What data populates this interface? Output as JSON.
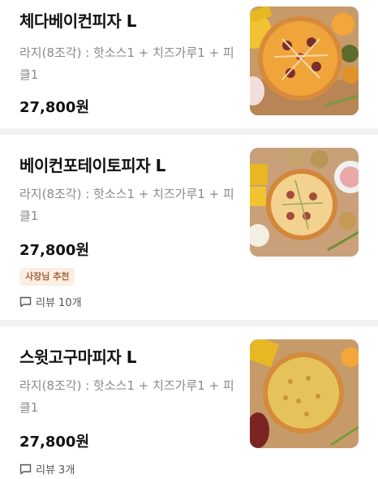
{
  "menu": {
    "items": [
      {
        "name": "체다베이컨피자 L",
        "desc": "라지(8조각) : 핫소스1 + 치즈가루1 + 피클1",
        "price": "27,800원",
        "image": "cheddar-bacon-pizza-photo"
      },
      {
        "name": "베이컨포테이토피자 L",
        "desc": "라지(8조각) : 핫소스1 + 치즈가루1 + 피클1",
        "price": "27,800원",
        "badge": "사장님 추천",
        "review": "리뷰 10개",
        "image": "bacon-potato-pizza-photo"
      },
      {
        "name": "스윗고구마피자 L",
        "desc": "라지(8조각) : 핫소스1 + 치즈가루1 + 피클1",
        "price": "27,800원",
        "review": "리뷰 3개",
        "image": "sweet-potato-pizza-photo"
      }
    ]
  },
  "colors": {
    "badge_text": "#a5653b",
    "badge_bg": "#fbeee4",
    "desc_text": "#8a8a8a"
  }
}
